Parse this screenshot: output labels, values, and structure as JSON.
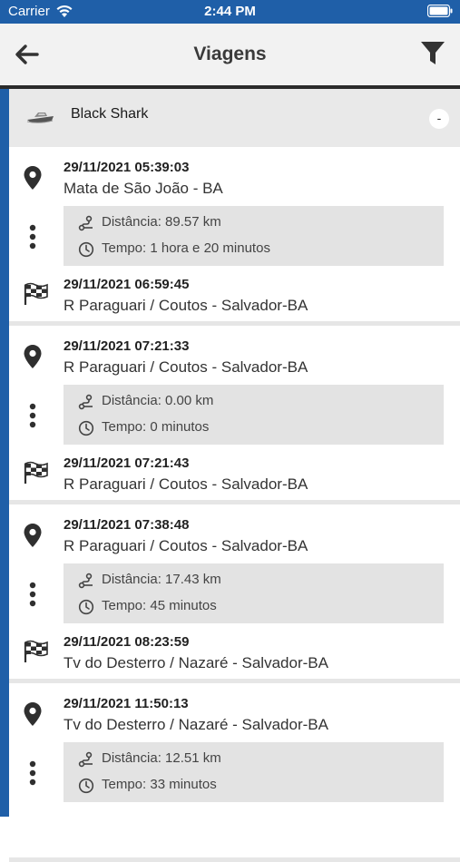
{
  "status_bar": {
    "carrier": "Carrier",
    "time": "2:44 PM",
    "wifi_icon": "wifi-icon",
    "battery_icon": "battery-icon"
  },
  "nav": {
    "title": "Viagens",
    "back_icon": "arrow-left-icon",
    "filter_icon": "filter-icon"
  },
  "vehicle": {
    "name": "Black Shark",
    "icon": "boat-icon",
    "collapse_label": "-"
  },
  "colors": {
    "accent": "#1f5fa8",
    "header_bg": "#f2f2f2",
    "group_bg": "#e9e9e9",
    "stats_bg": "#e3e3e3"
  },
  "trips": [
    {
      "start_time": "29/11/2021 05:39:03",
      "start_place": "Mata de São João - BA",
      "distance": "Distância: 89.57 km",
      "duration": "Tempo: 1 hora e 20 minutos",
      "end_time": "29/11/2021 06:59:45",
      "end_place": "R Paraguari / Coutos - Salvador-BA"
    },
    {
      "start_time": "29/11/2021 07:21:33",
      "start_place": "R Paraguari / Coutos - Salvador-BA",
      "distance": "Distância: 0.00 km",
      "duration": "Tempo: 0 minutos",
      "end_time": "29/11/2021 07:21:43",
      "end_place": "R Paraguari / Coutos - Salvador-BA"
    },
    {
      "start_time": "29/11/2021 07:38:48",
      "start_place": "R Paraguari / Coutos - Salvador-BA",
      "distance": "Distância: 17.43 km",
      "duration": "Tempo: 45 minutos",
      "end_time": "29/11/2021 08:23:59",
      "end_place": "Tv do Desterro / Nazaré - Salvador-BA"
    },
    {
      "start_time": "29/11/2021 11:50:13",
      "start_place": "Tv do Desterro / Nazaré - Salvador-BA",
      "distance": "Distância: 12.51 km",
      "duration": "Tempo: 33 minutos"
    }
  ]
}
